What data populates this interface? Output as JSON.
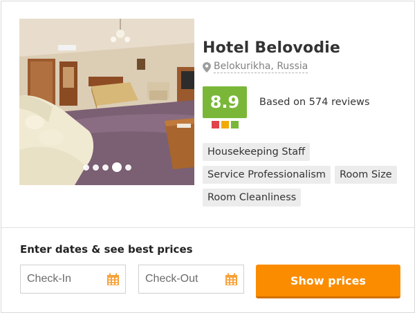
{
  "hotel": {
    "name": "Hotel Belovodie",
    "location": "Belokurikha, Russia",
    "score": "8.9",
    "reviews_text": "Based on 574 reviews",
    "rating_bar_colors": [
      "#e0434b",
      "#f2a900",
      "#7ab739"
    ]
  },
  "photo": {
    "alt": "Hotel room interior",
    "slides": 5,
    "active_slide": 4
  },
  "tags": [
    "Housekeeping Staff",
    "Service Professionalism",
    "Room Size",
    "Room Cleanliness"
  ],
  "booking": {
    "prompt": "Enter dates & see best prices",
    "checkin_placeholder": "Check-In",
    "checkout_placeholder": "Check-Out",
    "button_label": "Show prices"
  },
  "colors": {
    "accent": "#fb8c00",
    "score": "#7ab739"
  }
}
